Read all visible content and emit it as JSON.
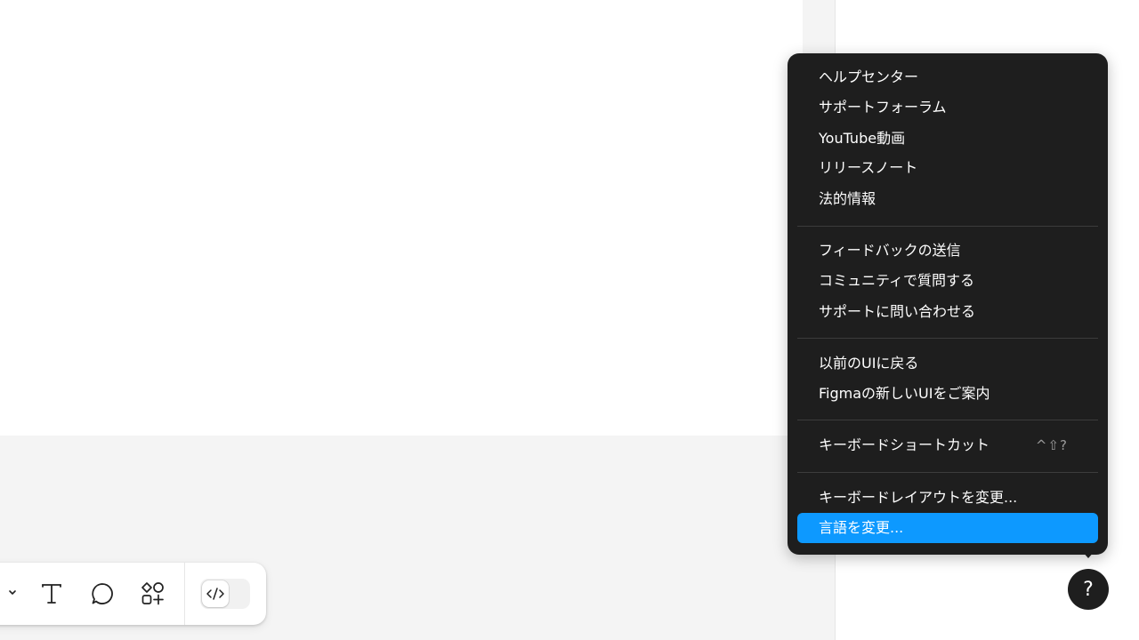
{
  "help_menu": {
    "group1": [
      "ヘルプセンター",
      "サポートフォーラム",
      "YouTube動画",
      "リリースノート",
      "法的情報"
    ],
    "group2": [
      "フィードバックの送信",
      "コミュニティで質問する",
      "サポートに問い合わせる"
    ],
    "group3": [
      "以前のUIに戻る",
      "Figmaの新しいUIをご案内"
    ],
    "group4": [
      {
        "label": "キーボードショートカット",
        "shortcut": "^⇧?"
      }
    ],
    "group5": [
      "キーボードレイアウトを変更...",
      "言語を変更..."
    ],
    "highlight_color": "#0d99ff"
  },
  "help_button": {
    "label": "?"
  },
  "toolbar": {
    "icons": [
      "chevron-down-icon",
      "text-tool-icon",
      "comment-icon",
      "resources-icon",
      "code-icon"
    ]
  }
}
